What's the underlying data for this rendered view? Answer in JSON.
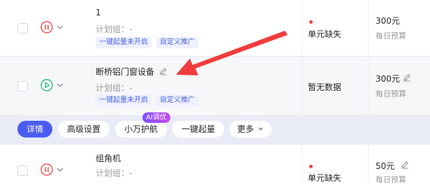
{
  "rows": [
    {
      "title": "1",
      "plan_label": "计划组：-",
      "tags": [
        "一键起量未开启",
        "自定义推广"
      ],
      "status": "单元缺失",
      "budget": "300元",
      "budget_label": "每日预算",
      "play_state": "paused"
    },
    {
      "title": "断桥铝门窗设备",
      "plan_label": "计划组：-",
      "tags": [
        "一键起量未开启",
        "自定义推广"
      ],
      "status": "暂无数据",
      "budget": "300元",
      "budget_label": "每日预算",
      "play_state": "running"
    },
    {
      "title": "组角机",
      "plan_label": "计划组：-",
      "status": "单元缺失",
      "budget": "50元",
      "budget_label": "每日预算",
      "play_state": "paused"
    }
  ],
  "actions": {
    "detail": "详情",
    "advanced": "高级设置",
    "assistant": "小万护航",
    "boost": "一键起量",
    "more": "更多",
    "ai_badge": "AI调优"
  },
  "colors": {
    "accent": "#4b5cf0",
    "paused_icon": "#f04a4a",
    "running_icon": "#2db47d",
    "arrow": "#f03c3c",
    "tag_text": "#4a63e0"
  },
  "icons": [
    "pause-circle-icon",
    "play-circle-icon",
    "chevron-down-icon",
    "edit-pencil-icon",
    "status-dot-icon",
    "red-annotation-arrow"
  ]
}
